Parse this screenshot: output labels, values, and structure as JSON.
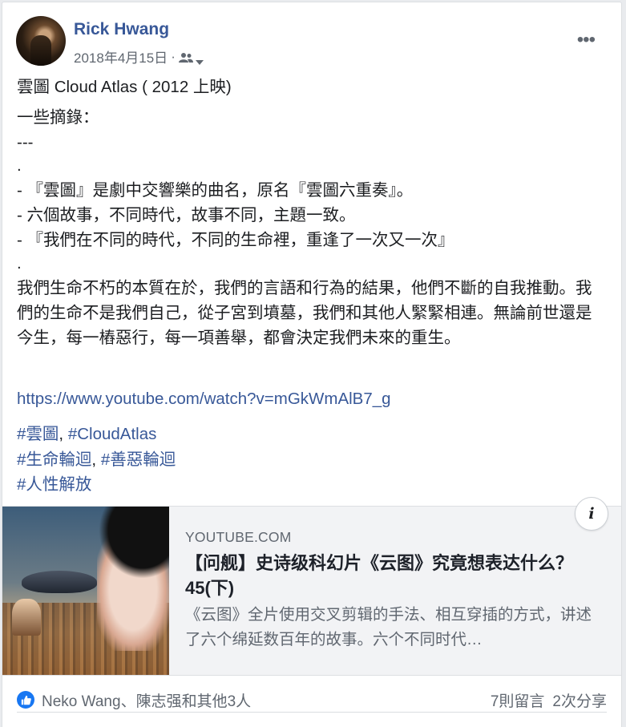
{
  "post": {
    "author": "Rick Hwang",
    "date": "2018年4月15日",
    "separator": "·",
    "audience_icon": "friends-icon",
    "lines": [
      "雲圖 Cloud Atlas ( 2012 上映)",
      "一些摘錄：",
      "---",
      ".",
      "- 『雲圖』是劇中交響樂的曲名，原名『雲圖六重奏』。",
      "- 六個故事，不同時代，故事不同，主題一致。",
      "- 『我們在不同的時代，不同的生命裡，重逢了一次又一次』",
      ".",
      "我們生命不朽的本質在於，我們的言語和行為的結果，他們不斷的自我推動。我們的生命不是我們自己，從子宮到墳墓，我們和其他人緊緊相連。無論前世還是今生，每一樁惡行，每一項善舉，都會決定我們未來的重生。"
    ],
    "link": "https://www.youtube.com/watch?v=mGkWmAlB7_g",
    "hashtags": {
      "line1": [
        "#雲圖",
        "#CloudAtlas"
      ],
      "line2": [
        "#生命輪迴",
        "#善惡輪迴"
      ],
      "line3": [
        "#人性解放"
      ],
      "comma": ", "
    }
  },
  "preview": {
    "domain": "YOUTUBE.COM",
    "title": "【问舰】史诗级科幻片《云图》究竟想表达什么？ 45(下)",
    "description": "《云图》全片使用交叉剪辑的手法、相互穿插的方式，讲述了六个绵延数百年的故事。六个不同时代…",
    "info_label": "i"
  },
  "footer": {
    "likers": "Neko Wang、陳志强和其他3人",
    "comments": "7則留言",
    "shares": "2次分享"
  },
  "colors": {
    "link": "#385898",
    "like": "#1877f2",
    "muted": "#606770"
  }
}
